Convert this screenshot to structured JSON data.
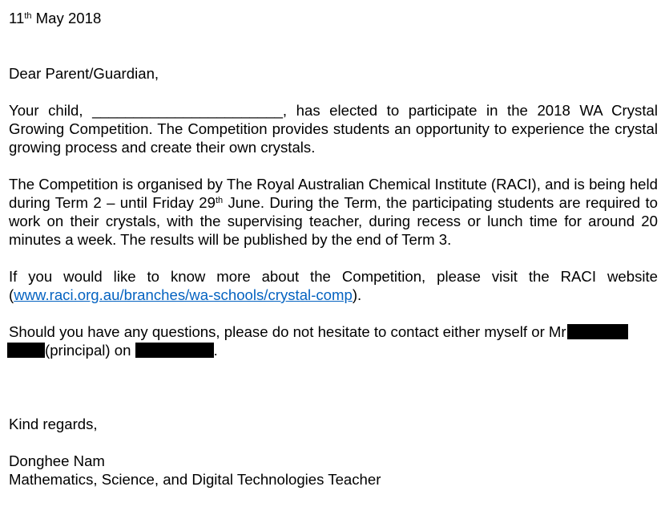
{
  "letter": {
    "date": {
      "day": "11",
      "suffix": "th",
      "rest": " May 2018"
    },
    "salutation": "Dear Parent/Guardian,",
    "para1": {
      "prefix": "Your child,",
      "blank": "_______________________",
      "text": ", has elected to participate in the 2018 WA Crystal Growing Competition. The Competition provides students an opportunity to experience the crystal growing process and create their own crystals."
    },
    "para2": {
      "before_sup": "The Competition is organised by The Royal Australian Chemical Institute (RACI), and is being held during Term 2 – until Friday 29",
      "sup": "th",
      "after_sup": " June. During the Term, the participating students are required to work on their crystals, with the supervising teacher, during recess or lunch time for around 20 minutes a week. The results will be published by the end of Term 3."
    },
    "para3": {
      "text": "If you would like to know more about the Competition, please visit the RACI website (",
      "link": "www.raci.org.au/branches/wa-schools/crystal-comp",
      "end": ")."
    },
    "para4": {
      "line1": "Should you have any questions, please do not hesitate to contact either myself or Mr",
      "principal": "(principal) on",
      "end": "."
    },
    "closing": "Kind regards,",
    "signature": {
      "name": "Donghee Nam",
      "title": "Mathematics, Science, and Digital Technologies Teacher"
    }
  },
  "colors": {
    "link": "#0563c1",
    "redaction": "#000000"
  }
}
